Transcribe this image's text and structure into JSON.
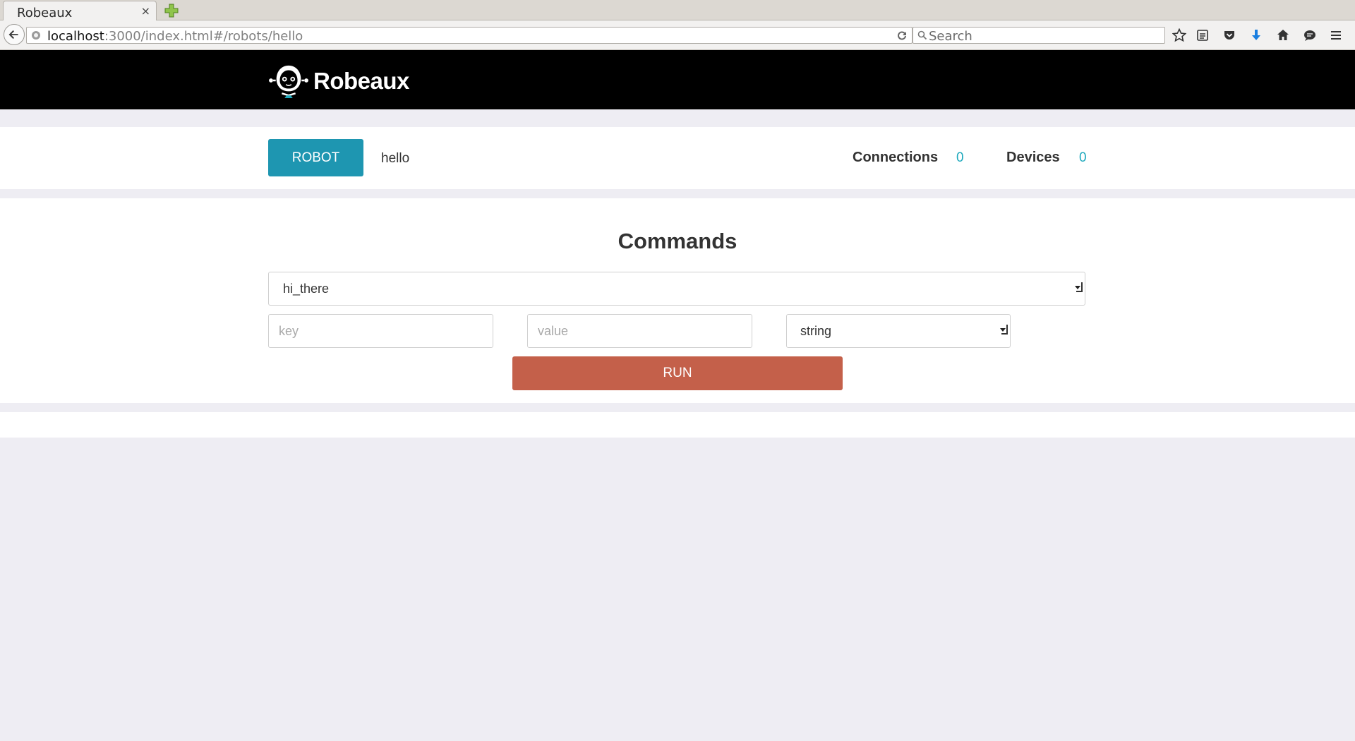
{
  "browser": {
    "tab_title": "Robeaux",
    "tab_close": "×",
    "url_host": "localhost",
    "url_rest": ":3000/index.html#/robots/hello",
    "search_placeholder": "Search"
  },
  "header": {
    "brand": "Robeaux"
  },
  "robot": {
    "button_label": "ROBOT",
    "name": "hello",
    "connections_label": "Connections",
    "connections_count": "0",
    "devices_label": "Devices",
    "devices_count": "0"
  },
  "commands": {
    "title": "Commands",
    "selected_command": "hi_there",
    "key_placeholder": "key",
    "value_placeholder": "value",
    "type_selected": "string",
    "run_label": "RUN"
  },
  "colors": {
    "robot_button": "#1e96b1",
    "run_button": "#c4604a",
    "count_accent": "#1ea9bd",
    "header_bg": "#000000",
    "page_bg": "#eeedf3"
  },
  "icons": [
    "close-icon",
    "new-tab-icon",
    "back-arrow-icon",
    "site-identity-icon",
    "reload-icon",
    "search-icon",
    "bookmark-star-icon",
    "reading-list-icon",
    "pocket-icon",
    "download-icon",
    "home-icon",
    "chat-icon",
    "menu-icon",
    "robot-logo-icon",
    "dropdown-caret-icon"
  ]
}
